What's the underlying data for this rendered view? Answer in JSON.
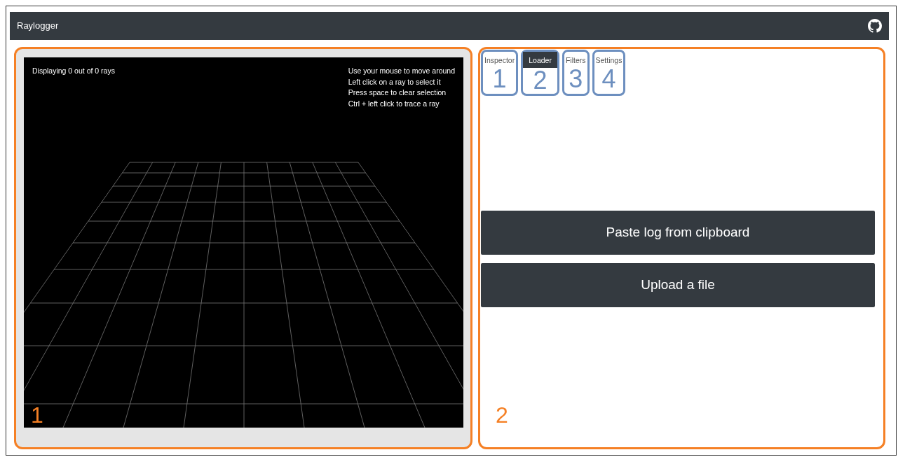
{
  "app": {
    "title": "Raylogger"
  },
  "viewer": {
    "status": "Displaying 0 out of 0 rays",
    "help": [
      "Use your mouse to move around",
      "Left click on a ray to select it",
      "Press space to clear selection",
      "Ctrl + left click to trace a ray"
    ],
    "callout": "1"
  },
  "panel": {
    "callout": "2",
    "tabs": [
      {
        "label": "Inspector",
        "selected": false,
        "callout": "1"
      },
      {
        "label": "Loader",
        "selected": true,
        "callout": "2"
      },
      {
        "label": "Filters",
        "selected": false,
        "callout": "3"
      },
      {
        "label": "Settings",
        "selected": false,
        "callout": "4"
      }
    ],
    "buttons": [
      "Paste log from clipboard",
      "Upload a file"
    ]
  }
}
